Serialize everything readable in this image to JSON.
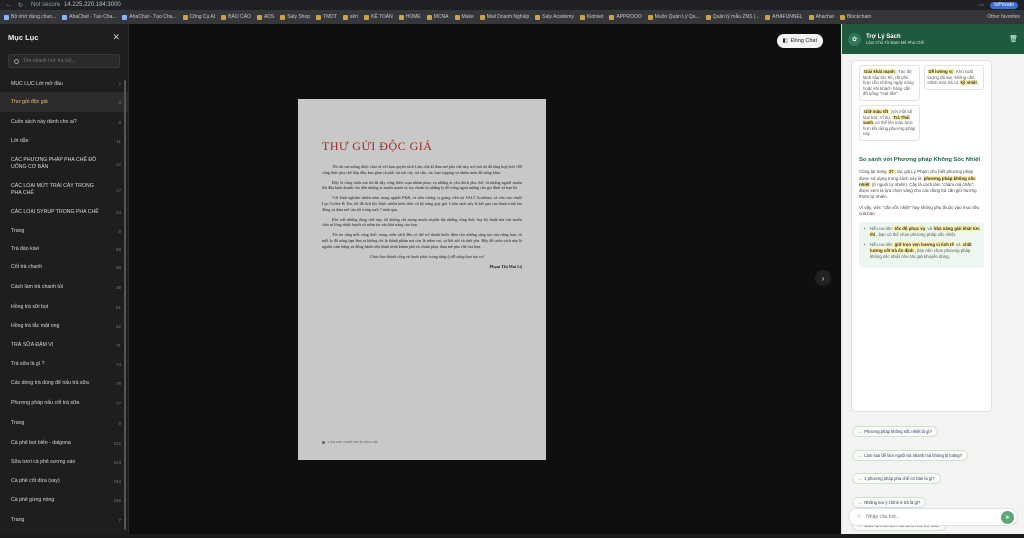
{
  "browser": {
    "security": "Not secure",
    "url": "14.225.220.184:3000",
    "profile": "InPrivate"
  },
  "bookmarks": [
    "Bộ nhớ dùng chun...",
    "AhaChat - Tạo Cha...",
    "AhaChat - Tạo Cha...",
    "Công Cụ AI",
    "BÁO CÁO",
    "ADS",
    "Saly Shop",
    "TMDT",
    "sên",
    "KẾ TOÁN",
    "HOME",
    "MCNA",
    "Make",
    "Mail Doanh Nghiệp",
    "Saly Academy",
    "Kiotviet",
    "APPROOO",
    "Muốn Quản Lý Qu...",
    "Quản lý mẫu ZNS |...",
    "AHAFUNNEL",
    "Ahachat",
    "Blockchain"
  ],
  "bookmarks_other": "Other favorites",
  "sidebar": {
    "title": "Mục Lục",
    "search_placeholder": "Tìm nhanh (vd: trà lài)...",
    "items": [
      {
        "label": "MỤC LỤC Lời mở đầu",
        "page": "7"
      },
      {
        "label": "Thư gửi độc giả",
        "page": "8"
      },
      {
        "label": "Cuốn sách này dành cho ai?",
        "page": "9"
      },
      {
        "label": "Lời dẫn",
        "page": "11"
      },
      {
        "label": "CÁC PHƯƠNG PHÁP PHA CHẾ ĐỒ UỐNG CƠ BẢN",
        "page": "12"
      },
      {
        "label": "CÁC LOẠI MỨT TRÁI CÂY TRONG PHA CHẾ",
        "page": "17"
      },
      {
        "label": "CÁC LOẠI SYRUP TRONG PHA CHẾ",
        "page": "24"
      },
      {
        "label": "Trang",
        "page": "5"
      },
      {
        "label": "Trà đào kiwi",
        "page": "69"
      },
      {
        "label": "Cốt trà chanh",
        "page": "38"
      },
      {
        "label": "Cách làm trà chanh tủi",
        "page": "39"
      },
      {
        "label": "Hồng trà sữi bọt",
        "page": "51"
      },
      {
        "label": "Hồng trà tắc mật ong",
        "page": "52"
      },
      {
        "label": "TRÀ SỮA ĐẬM VỊ",
        "page": "71"
      },
      {
        "label": "Trà sữa là gì ?",
        "page": "74"
      },
      {
        "label": "Các dòng trà dùng để nấu trà sữa",
        "page": "76"
      },
      {
        "label": "Phương pháp nấu cốt trà sữa",
        "page": "77"
      },
      {
        "label": "Trang",
        "page": "6"
      },
      {
        "label": "Cà phê bọt biển - dalgona",
        "page": "152"
      },
      {
        "label": "Sữa tươi cà phê sương sáo",
        "page": "153"
      },
      {
        "label": "Cà phê cốt dừa (xay)",
        "page": "154"
      },
      {
        "label": "Cà phê gừng nóng",
        "page": "156"
      },
      {
        "label": "Trang",
        "page": "7"
      }
    ]
  },
  "viewer": {
    "close_chat_label": "Đóng Chat",
    "page": {
      "title": "THƯ GỬI ĐỘC GIẢ",
      "paragraphs": [
        "Tôi rất vui mừng được chia sẻ với bạn quyển sách Làm chủ kĩ đam mê pha chế này, nơi mà tôi đã tổng hợp hơn 100 công thức pha chế hấp dẫn, bao gồm cà phê, trà trái cây, trà sữa, các loại topping và nhiều món đồ uống khác.",
        "Đây là công trình mà tôi đã dày công biên soạn nhằm phục vụ những ai yêu thích pha chế, từ những người muốn bắt đầu kinh doanh cho đến những ai muốn muốn tự tay chuẩn bị những ly đồ uống ngon miệng cho gia đình và bạn bè.",
        "Với kinh nghiệm nhiều năm trong ngành F&B, cả trên cương vị giảng viên tại SALT Academy và chủ của chuỗi Lục Coffee & Tea, tôi đã tích lũy được nhiều kiến thức và kỹ năng quý giá. Cuốn sách này là kết quả của hành trình lao động và đam mê của tôi trong suốt 7 năm qua.",
        "Khi viết những dòng chữ này, tôi không chỉ mong muốn truyền đạt những công thức hay kỹ thuật mà còn muốn chia sẻ lòng nhiệt huyết và niềm tin vào khả năng của bạn.",
        "Tôi tin rằng mỗi công thức trong cuốn sách đều có thể trở thành bước đệm cho những sáng tạo của riêng bạn, và mỗi ly đồ uống bạn làm ra không chỉ là thành phẩm mà còn là niềm vui, sự kết nối và tình yêu. Hãy để cuốn sách này là nguồn cảm hứng và đồng hành trên hành trình khám phá và chinh phục đam mê pha chế của bạn."
      ],
      "closing": "Chúc bạn thành công và hạnh phúc trong từng ly đồ uống bạn tạo ra!",
      "author": "Phạm Thị Mai Lệ",
      "footer": "LÀM CHỦ NGHỆ THUẬT PHA CHẾ"
    }
  },
  "chat": {
    "title": "Trợ Lý Sách",
    "subtitle": "Làm Chủ Từ Đam Mê Pha Chế",
    "card1": {
      "a": "Giải khát mạnh",
      "b": ": Tạo độ lạnh sâu tức thì, rất phù hợp cho những ngày nóng hoặc khi khách hàng cần đồ uống \"mát liền\"."
    },
    "card2": {
      "a": "Giữ màu tốt",
      "b": " (với một số loại trà): Ví dụ, ",
      "c": "Trà Thái xanh",
      "d": " có thể lên màu tươi hơn khi dùng phương pháp này."
    },
    "card3": {
      "a": "Dễ lường vị",
      "b": ": Khó soát lượng đá tan, không cần chỉnh sửa trà có ",
      "c": "kỹ nhiệt",
      "d": "."
    },
    "heading": "So sánh với Phương pháp Không Sốc Nhiệt",
    "p1": {
      "a": "Cũng tại trang ",
      "b": "27",
      "c": ", tác giả Lý Phạm cho biết phương pháp được sử dụng trong sách này là ",
      "d": "phương pháp không sốc nhiệt",
      "e": " (ở nguội tự nhiên). Cây lá cách làm \"chậm mà chắc\", được xem là lựa chọn vàng cho các dòng trà cần giữ hương thơm tự nhiên."
    },
    "p2": "Vì vậy, việc \"cần sốc nhiệt\" hay không phụ thuộc vào mục tiêu của bạn:",
    "b1": {
      "a": "Nếu ưu tiên ",
      "b": "tốc độ phục vụ",
      "c": " và ",
      "d": "khả năng giải khát tức thì",
      "e": ", bạn có thể chọn phương pháp sốc nhiệt."
    },
    "b2": {
      "a": "Nếu ưu tiên ",
      "b": "giữ trọn vẹn hương vị tinh tế",
      "c": " và ",
      "d": "chất lượng cốt trà ổn định",
      "e": ", bạn nên chọn phương pháp không sốc nhiệt như tác giả khuyến dùng."
    },
    "suggestions": [
      "Phương pháp không sốc nhiệt là gì?",
      "Làm sao để làm nguội trà nhanh mà không bị loãng?",
      "1 phương pháp pha chế cơ bản là gì?",
      "Những lưu ý chính ở trà là gì?",
      "Cách làm cốt trà Thái xanh như thế nào?"
    ],
    "input_placeholder": "Nhập câu hỏi..."
  }
}
